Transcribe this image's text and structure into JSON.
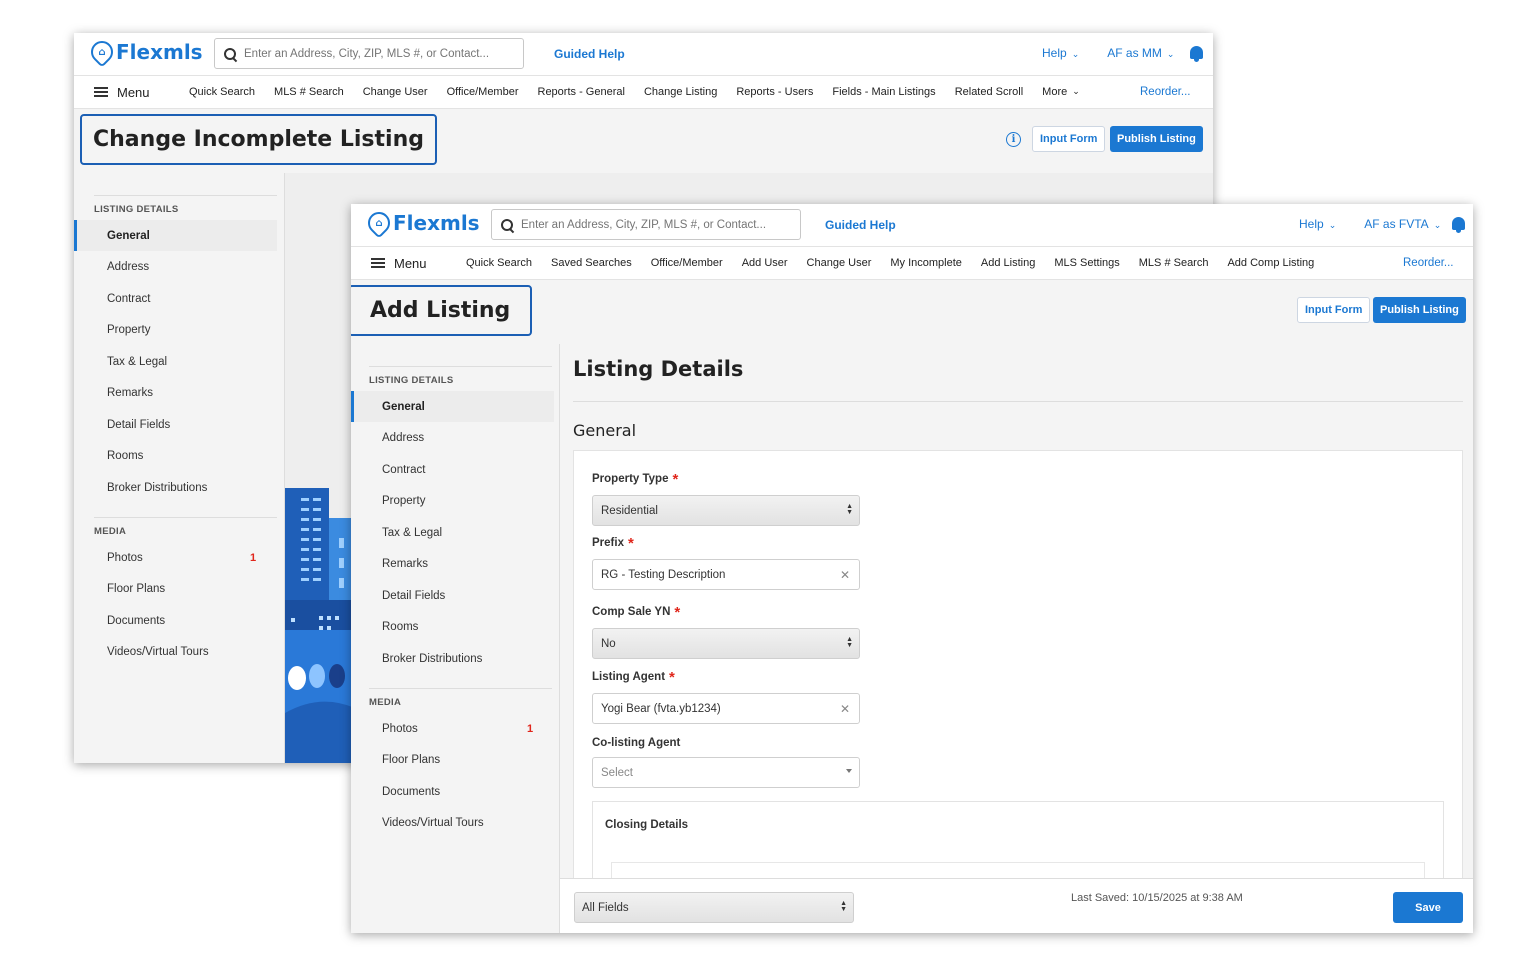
{
  "brand": {
    "name": "Flexmls",
    "color": "#1b78d2"
  },
  "search": {
    "placeholder": "Enter an Address, City, ZIP, MLS #, or Contact..."
  },
  "back_window": {
    "guided_help": "Guided Help",
    "help": "Help",
    "user": "AF as MM",
    "menu_label": "Menu",
    "nav": [
      "Quick Search",
      "MLS # Search",
      "Change User",
      "Office/Member",
      "Reports - General",
      "Change Listing",
      "Reports - Users",
      "Fields - Main Listings",
      "Related Scroll",
      "More"
    ],
    "reorder": "Reorder...",
    "page_title": "Change Incomplete Listing",
    "input_form": "Input Form",
    "publish": "Publish Listing",
    "listing_details_label": "LISTING DETAILS",
    "listing_items": [
      "General",
      "Address",
      "Contract",
      "Property",
      "Tax & Legal",
      "Remarks",
      "Detail Fields",
      "Rooms",
      "Broker Distributions"
    ],
    "media_label": "MEDIA",
    "media_items": [
      "Photos",
      "Floor Plans",
      "Documents",
      "Videos/Virtual Tours"
    ],
    "photos_badge": "1"
  },
  "front_window": {
    "guided_help": "Guided Help",
    "help": "Help",
    "user": "AF as FVTA",
    "menu_label": "Menu",
    "nav": [
      "Quick Search",
      "Saved Searches",
      "Office/Member",
      "Add User",
      "Change User",
      "My Incomplete",
      "Add Listing",
      "MLS Settings",
      "MLS # Search",
      "Add Comp Listing"
    ],
    "reorder": "Reorder...",
    "page_title": "Add Listing",
    "input_form": "Input Form",
    "publish": "Publish Listing",
    "listing_details_label": "LISTING DETAILS",
    "listing_items": [
      "General",
      "Address",
      "Contract",
      "Property",
      "Tax & Legal",
      "Remarks",
      "Detail Fields",
      "Rooms",
      "Broker Distributions"
    ],
    "media_label": "MEDIA",
    "media_items": [
      "Photos",
      "Floor Plans",
      "Documents",
      "Videos/Virtual Tours"
    ],
    "photos_badge": "1",
    "section_title": "Listing Details",
    "subsection_title": "General",
    "fields": {
      "property_type": {
        "label": "Property Type",
        "value": "Residential",
        "required": "*"
      },
      "prefix": {
        "label": "Prefix",
        "value": "RG - Testing Description",
        "required": "*"
      },
      "comp_sale": {
        "label": "Comp Sale YN",
        "value": "No",
        "required": "*"
      },
      "listing_agent": {
        "label": "Listing Agent",
        "value": "Yogi Bear (fvta.yb1234)",
        "required": "*"
      },
      "co_listing_agent": {
        "label": "Co-listing Agent",
        "placeholder": "Select"
      }
    },
    "closing_details": "Closing Details",
    "footer": {
      "filter": "All Fields",
      "last_saved": "Last Saved: 10/15/2025 at 9:38 AM",
      "save": "Save"
    }
  }
}
